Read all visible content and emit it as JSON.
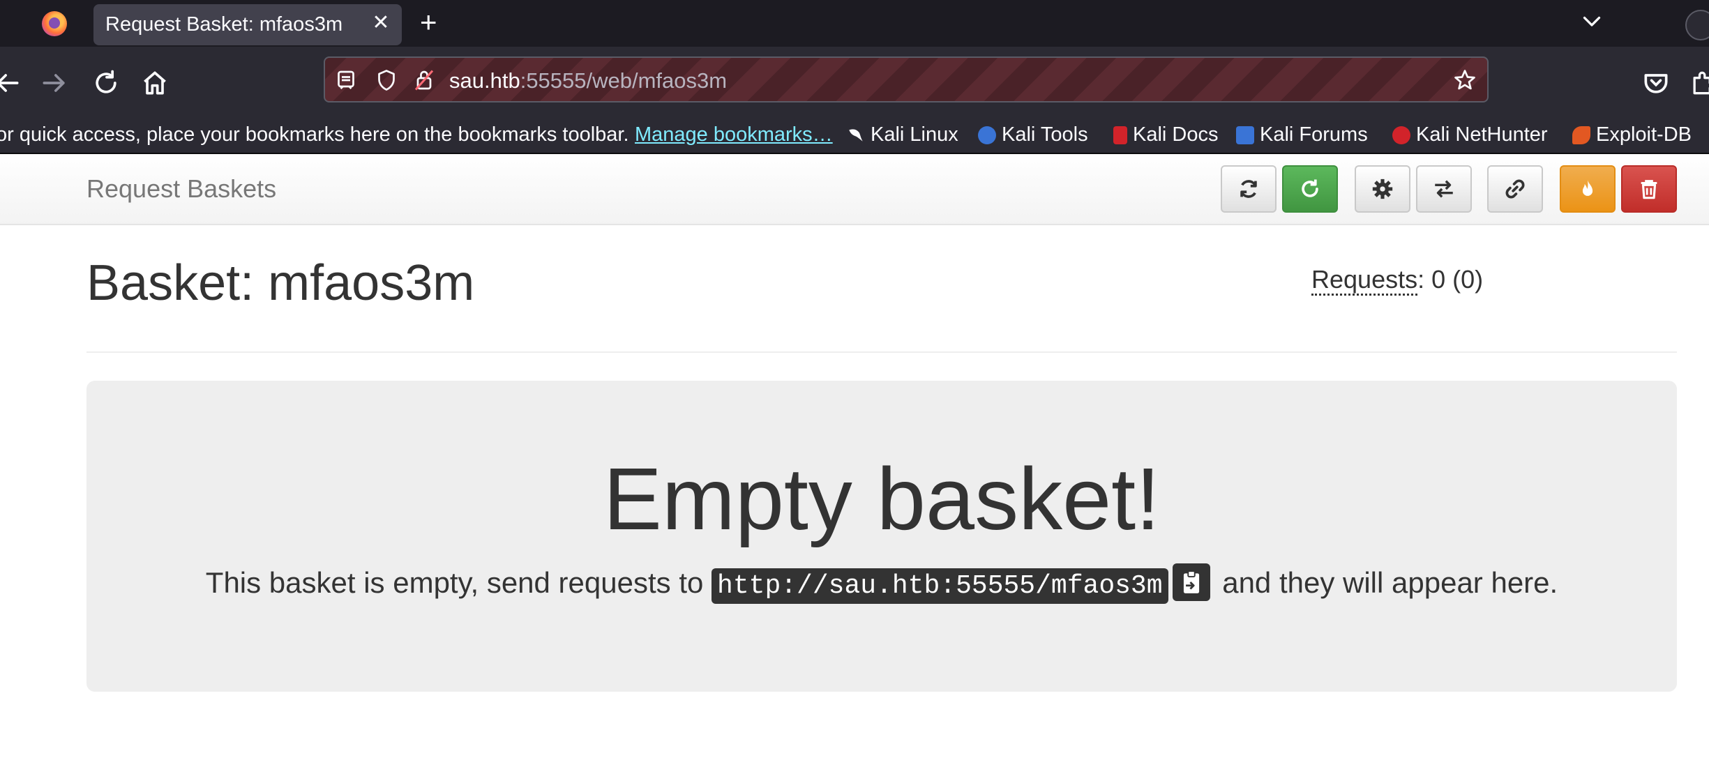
{
  "browser": {
    "tab_title": "Request Basket: mfaos3m",
    "tab_close": "✕",
    "new_tab": "+",
    "url_host": "sau.htb",
    "url_path": ":55555/web/mfaos3m",
    "bookmarks_hint": "or quick access, place your bookmarks here on the bookmarks toolbar.",
    "manage_bookmarks": "Manage bookmarks…",
    "bookmarks": [
      {
        "label": "Kali Linux",
        "icon": "kali-dragon-icon",
        "color": "#2d2d2d"
      },
      {
        "label": "Kali Tools",
        "icon": "kali-tools-icon",
        "color": "#3a74d6"
      },
      {
        "label": "Kali Docs",
        "icon": "kali-docs-icon",
        "color": "#d2232a"
      },
      {
        "label": "Kali Forums",
        "icon": "kali-forums-icon",
        "color": "#3a74d6"
      },
      {
        "label": "Kali NetHunter",
        "icon": "kali-nethunter-icon",
        "color": "#d2232a"
      },
      {
        "label": "Exploit-DB",
        "icon": "exploit-db-icon",
        "color": "#e25822"
      }
    ]
  },
  "app": {
    "brand": "Request Baskets",
    "toolbar": [
      {
        "name": "refresh-button",
        "icon": "refresh-icon",
        "style": "default"
      },
      {
        "name": "auto-refresh-button",
        "icon": "auto-refresh-icon",
        "style": "green"
      },
      {
        "name": "settings-button",
        "icon": "gear-icon",
        "style": "default"
      },
      {
        "name": "responses-button",
        "icon": "exchange-icon",
        "style": "default"
      },
      {
        "name": "share-link-button",
        "icon": "link-icon",
        "style": "default"
      },
      {
        "name": "clear-basket-button",
        "icon": "fire-icon",
        "style": "orange"
      },
      {
        "name": "delete-basket-button",
        "icon": "trash-icon",
        "style": "red"
      }
    ],
    "colors": {
      "green": "#5cb85c",
      "orange": "#f0ad4e",
      "red": "#d9534f"
    }
  },
  "basket": {
    "title": "Basket: mfaos3m",
    "requests_label": "Requests",
    "requests_count": ": 0 (0)",
    "empty_heading": "Empty basket!",
    "empty_text_before": "This basket is empty, send requests to",
    "url": "http://sau.htb:55555/mfaos3m",
    "empty_text_after": "and they will appear here."
  }
}
